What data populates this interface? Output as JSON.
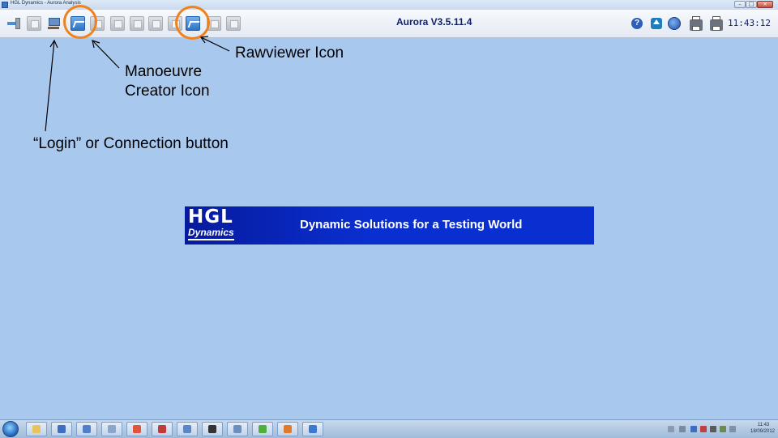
{
  "window": {
    "title": "HGL Dynamics - Aurora Analysis",
    "controls": {
      "minimize": "–",
      "maximize": "□",
      "close": "×"
    }
  },
  "toolbar": {
    "version": "Aurora V3.5.11.4",
    "clock": "11:43:12",
    "help_glyph": "?",
    "left_icons": [
      "exit-icon",
      "network-icon",
      "login-icon",
      "manoeuvre-creator-icon",
      "document-icon",
      "tool-icon",
      "check-icon",
      "list-icon",
      "edit-icon",
      "rawviewer-icon",
      "chart-icon",
      "graph-icon"
    ],
    "right_icons": [
      "help-icon",
      "upload-icon",
      "globe-icon",
      "printer-icon",
      "printer-icon"
    ]
  },
  "annotations": {
    "rawviewer": "Rawviewer Icon",
    "manoeuvre": "Manoeuvre Creator Icon",
    "login": "“Login” or Connection button"
  },
  "banner": {
    "logo_top": "HGL",
    "logo_bottom": "Dynamics",
    "tagline": "Dynamic Solutions for a Testing World"
  },
  "taskbar": {
    "time": "11:43",
    "date": "18/09/2012",
    "apps": [
      "explorer",
      "security",
      "shield",
      "network-map",
      "media",
      "rm-app",
      "clock-app",
      "photo-app",
      "paint-app",
      "chat-app",
      "office-app",
      "aurora-app"
    ],
    "colors": {
      "accent": "#f0821e",
      "banner": "#0a2fd0",
      "background": "#a9c8ee"
    }
  }
}
